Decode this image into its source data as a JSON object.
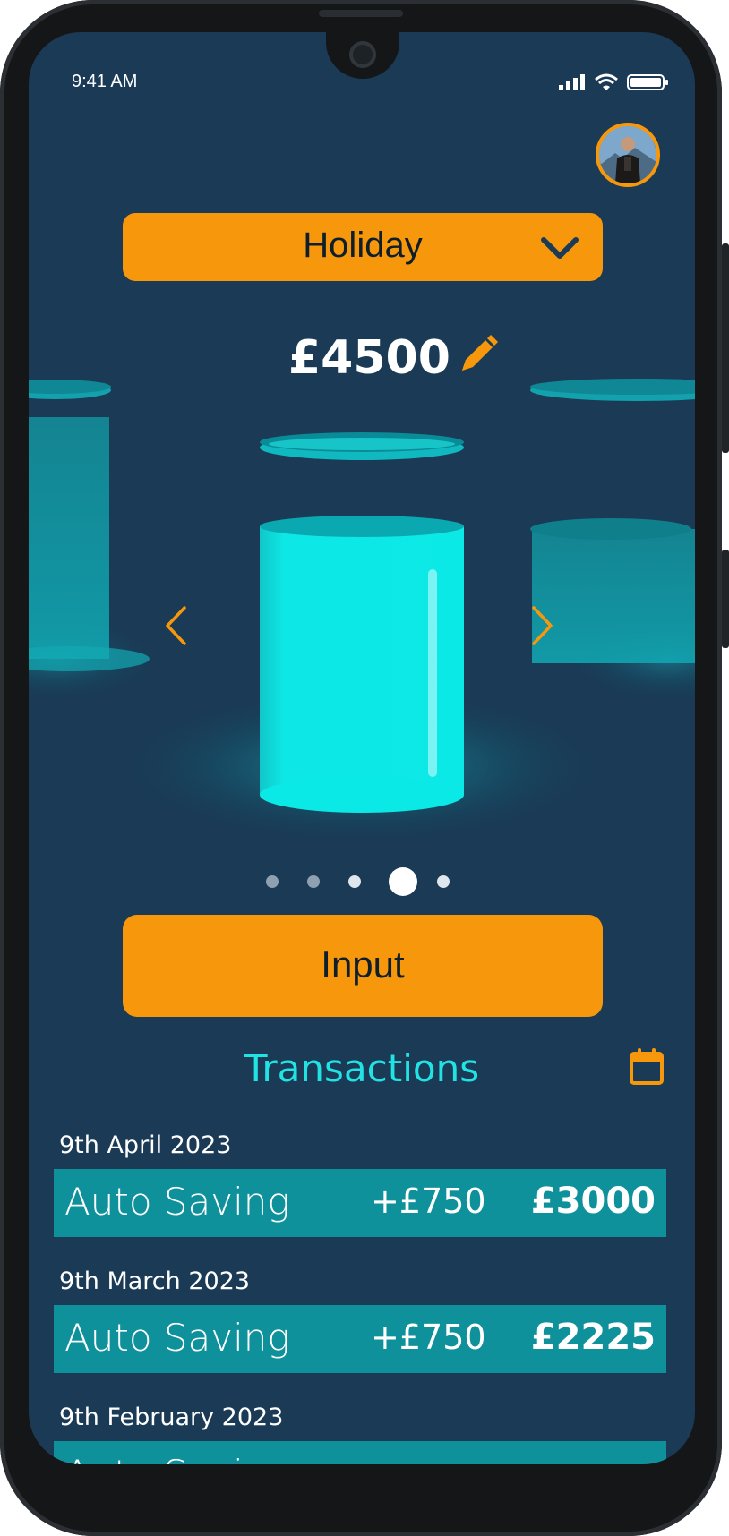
{
  "status_bar": {
    "time": "9:41 AM"
  },
  "goal": {
    "selected": "Holiday",
    "amount": "£4500"
  },
  "carousel": {
    "pages": 5,
    "active_index": 3
  },
  "actions": {
    "input_label": "Input"
  },
  "transactions": {
    "title": "Transactions",
    "items": [
      {
        "date": "9th April 2023",
        "name": "Auto Saving",
        "delta": "+£750",
        "total": "£3000"
      },
      {
        "date": "9th March 2023",
        "name": "Auto Saving",
        "delta": "+£750",
        "total": "£2225"
      },
      {
        "date": "9th February 2023",
        "name": "Auto Saving",
        "delta": "",
        "total": ""
      }
    ]
  },
  "colors": {
    "background": "#1a3a55",
    "accent": "#f7980c",
    "teal": "#0e919b",
    "cyan": "#22e3e3"
  },
  "icons": [
    "signal-icon",
    "wifi-icon",
    "battery-icon",
    "avatar",
    "chevron-down-icon",
    "edit-pencil-icon",
    "chevron-left-icon",
    "chevron-right-icon",
    "calendar-icon"
  ]
}
